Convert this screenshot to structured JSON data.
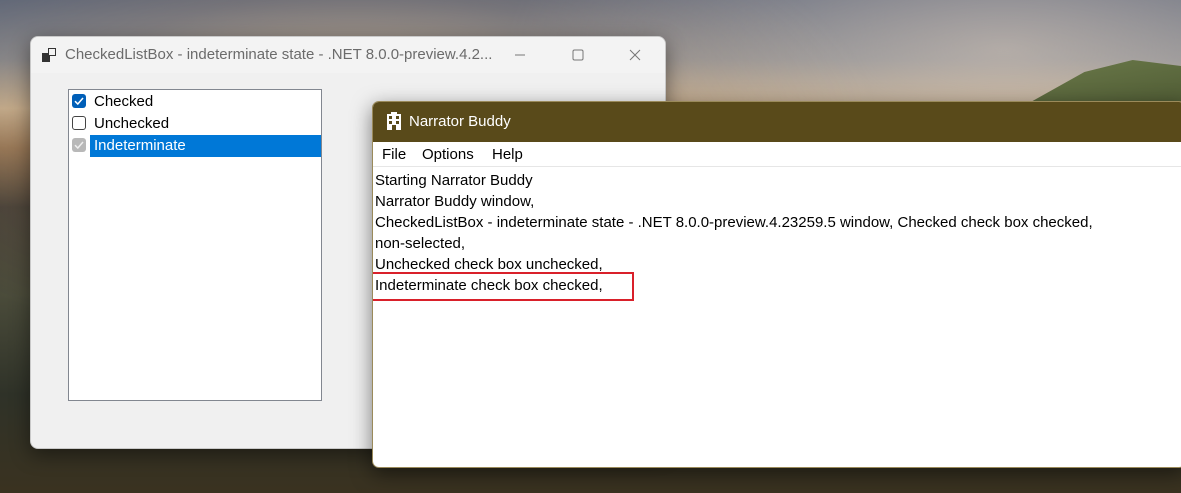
{
  "winforms_window": {
    "title": "CheckedListBox - indeterminate state - .NET 8.0.0-preview.4.2...",
    "items": [
      {
        "label": "Checked",
        "state": "checked"
      },
      {
        "label": "Unchecked",
        "state": "unchecked"
      },
      {
        "label": "Indeterminate",
        "state": "indeterminate"
      }
    ]
  },
  "narrator_window": {
    "title": "Narrator Buddy",
    "menu": [
      "File",
      "Options",
      "Help"
    ],
    "log": [
      "Starting Narrator Buddy",
      "Narrator Buddy window,",
      "CheckedListBox - indeterminate state - .NET 8.0.0-preview.4.23259.5 window, Checked check box checked,",
      "non-selected,",
      "Unchecked check box unchecked,",
      "Indeterminate check box checked,"
    ]
  },
  "colors": {
    "narrator_titlebar": "#594a1a",
    "selection": "#0078d7",
    "highlight_box": "#d9202a"
  }
}
